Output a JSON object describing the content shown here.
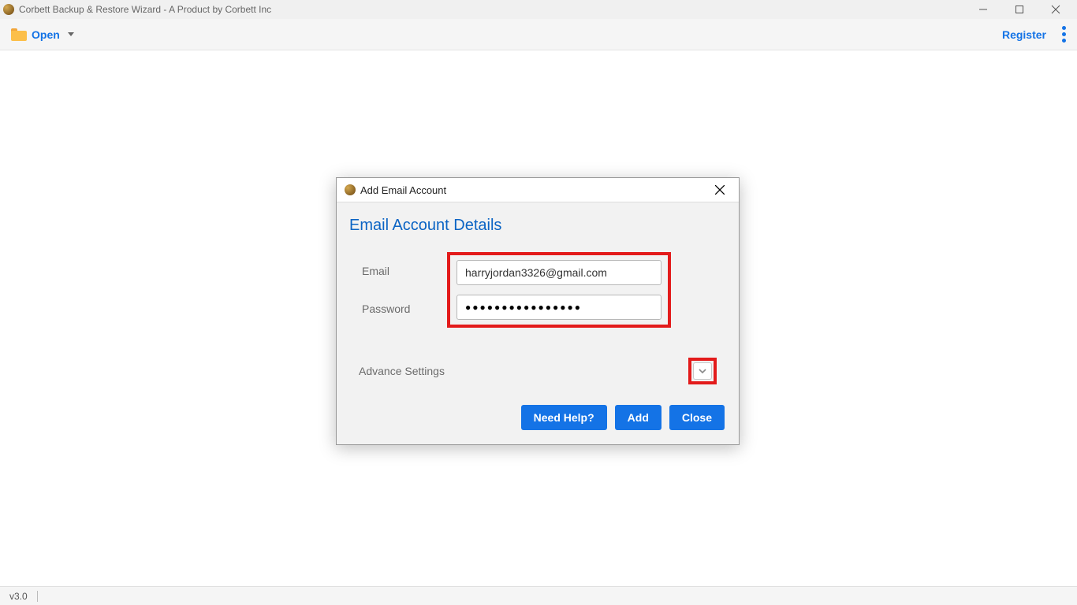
{
  "window": {
    "title": "Corbett Backup & Restore Wizard - A Product by Corbett Inc"
  },
  "toolbar": {
    "open_label": "Open",
    "register_label": "Register"
  },
  "modal": {
    "title": "Add Email Account",
    "heading": "Email Account Details",
    "labels": {
      "email": "Email",
      "password": "Password",
      "advance": "Advance Settings"
    },
    "fields": {
      "email": "harryjordan3326@gmail.com",
      "password_masked": "●●●●●●●●●●●●●●●●"
    },
    "buttons": {
      "help": "Need Help?",
      "add": "Add",
      "close": "Close"
    }
  },
  "statusbar": {
    "version": "v3.0"
  }
}
